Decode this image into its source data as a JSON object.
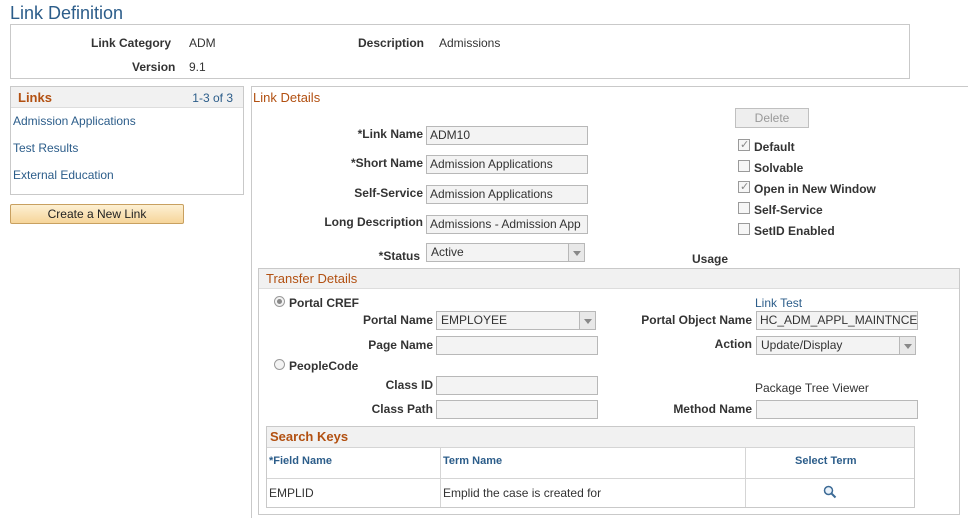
{
  "page": {
    "title": "Link Definition"
  },
  "header": {
    "link_category_label": "Link Category",
    "link_category_value": "ADM",
    "description_label": "Description",
    "description_value": "Admissions",
    "version_label": "Version",
    "version_value": "9.1"
  },
  "links": {
    "title": "Links",
    "count": "1-3 of 3",
    "items": [
      "Admission Applications",
      "Test Results",
      "External Education"
    ],
    "create_button": "Create a New Link"
  },
  "details": {
    "title": "Link Details",
    "link_name_label": "*Link Name",
    "link_name_value": "ADM10",
    "short_name_label": "*Short Name",
    "short_name_value": "Admission Applications",
    "self_service_label": "Self-Service",
    "self_service_value": "Admission Applications",
    "long_description_label": "Long Description",
    "long_description_value": "Admissions - Admission App",
    "status_label": "*Status",
    "status_value": "Active",
    "delete_button": "Delete",
    "usage_label": "Usage",
    "checkboxes": [
      {
        "label": "Default",
        "checked": true
      },
      {
        "label": "Solvable",
        "checked": false
      },
      {
        "label": "Open in New Window",
        "checked": true
      },
      {
        "label": "Self-Service",
        "checked": false
      },
      {
        "label": "SetID Enabled",
        "checked": false
      }
    ]
  },
  "transfer": {
    "title": "Transfer Details",
    "portal_cref_label": "Portal CREF",
    "portal_name_label": "Portal Name",
    "portal_name_value": "EMPLOYEE",
    "link_test": "Link Test",
    "portal_object_name_label": "Portal Object Name",
    "portal_object_name_value": "HC_ADM_APPL_MAINTNCE_",
    "page_name_label": "Page Name",
    "page_name_value": "",
    "action_label": "Action",
    "action_value": "Update/Display",
    "peoplecode_label": "PeopleCode",
    "class_id_label": "Class ID",
    "class_id_value": "",
    "package_tree_viewer": "Package Tree Viewer",
    "class_path_label": "Class Path",
    "class_path_value": "",
    "method_name_label": "Method Name",
    "method_name_value": ""
  },
  "search_keys": {
    "title": "Search Keys",
    "columns": [
      "*Field Name",
      "Term Name",
      "Select Term"
    ],
    "rows": [
      {
        "field_name": "EMPLID",
        "term_name": "Emplid the case is created for"
      }
    ]
  }
}
